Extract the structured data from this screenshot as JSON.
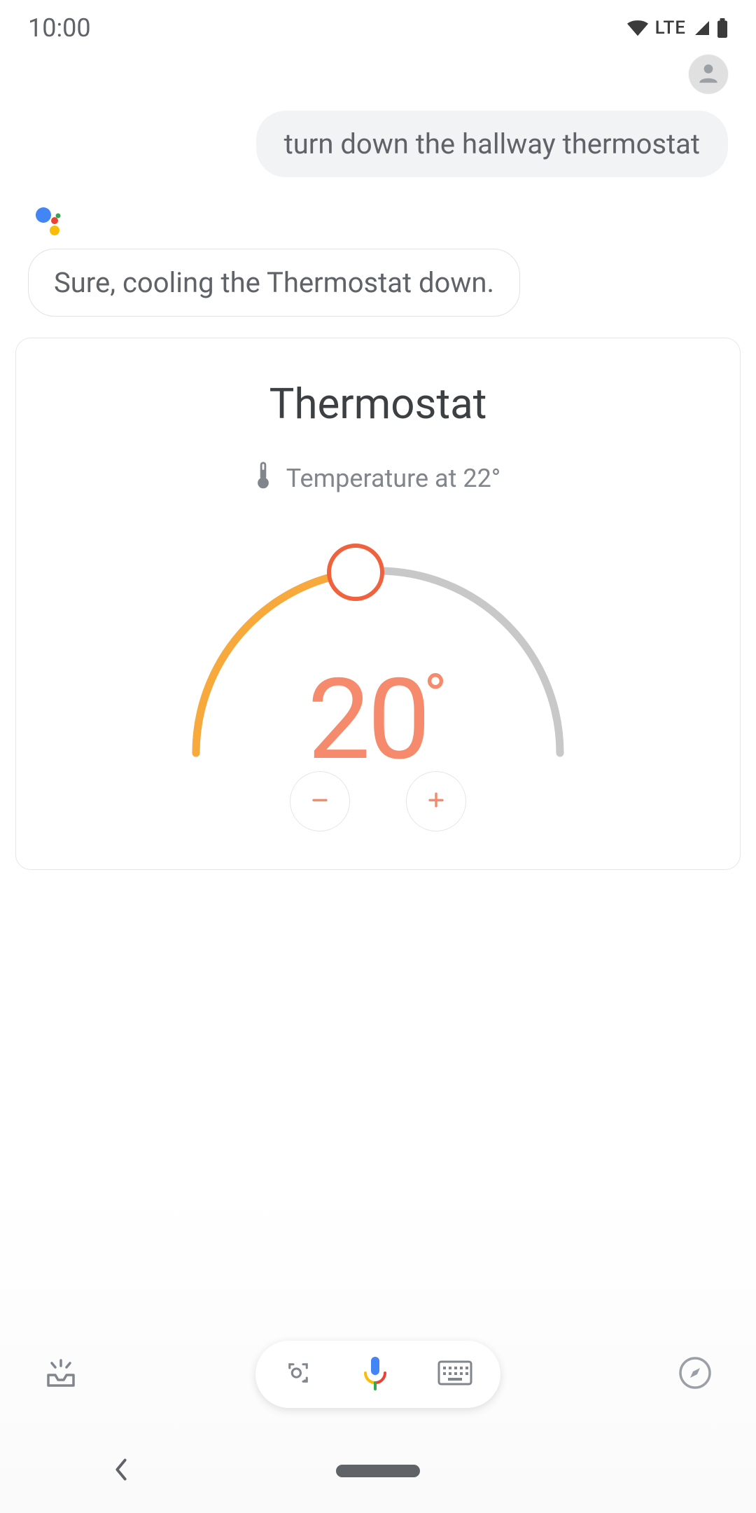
{
  "status": {
    "time": "10:00",
    "network_label": "LTE"
  },
  "chat": {
    "user_query": "turn down the hallway thermostat",
    "assistant_reply": "Sure, cooling the Thermostat down."
  },
  "thermostat": {
    "title": "Thermostat",
    "current_label": "Temperature at 22°",
    "setpoint": "20",
    "degree": "°"
  },
  "colors": {
    "accent": "#f58b6c",
    "arc_active": "#f8a93c",
    "arc_inactive": "#c8c8c8",
    "text_secondary": "#5f6368"
  }
}
